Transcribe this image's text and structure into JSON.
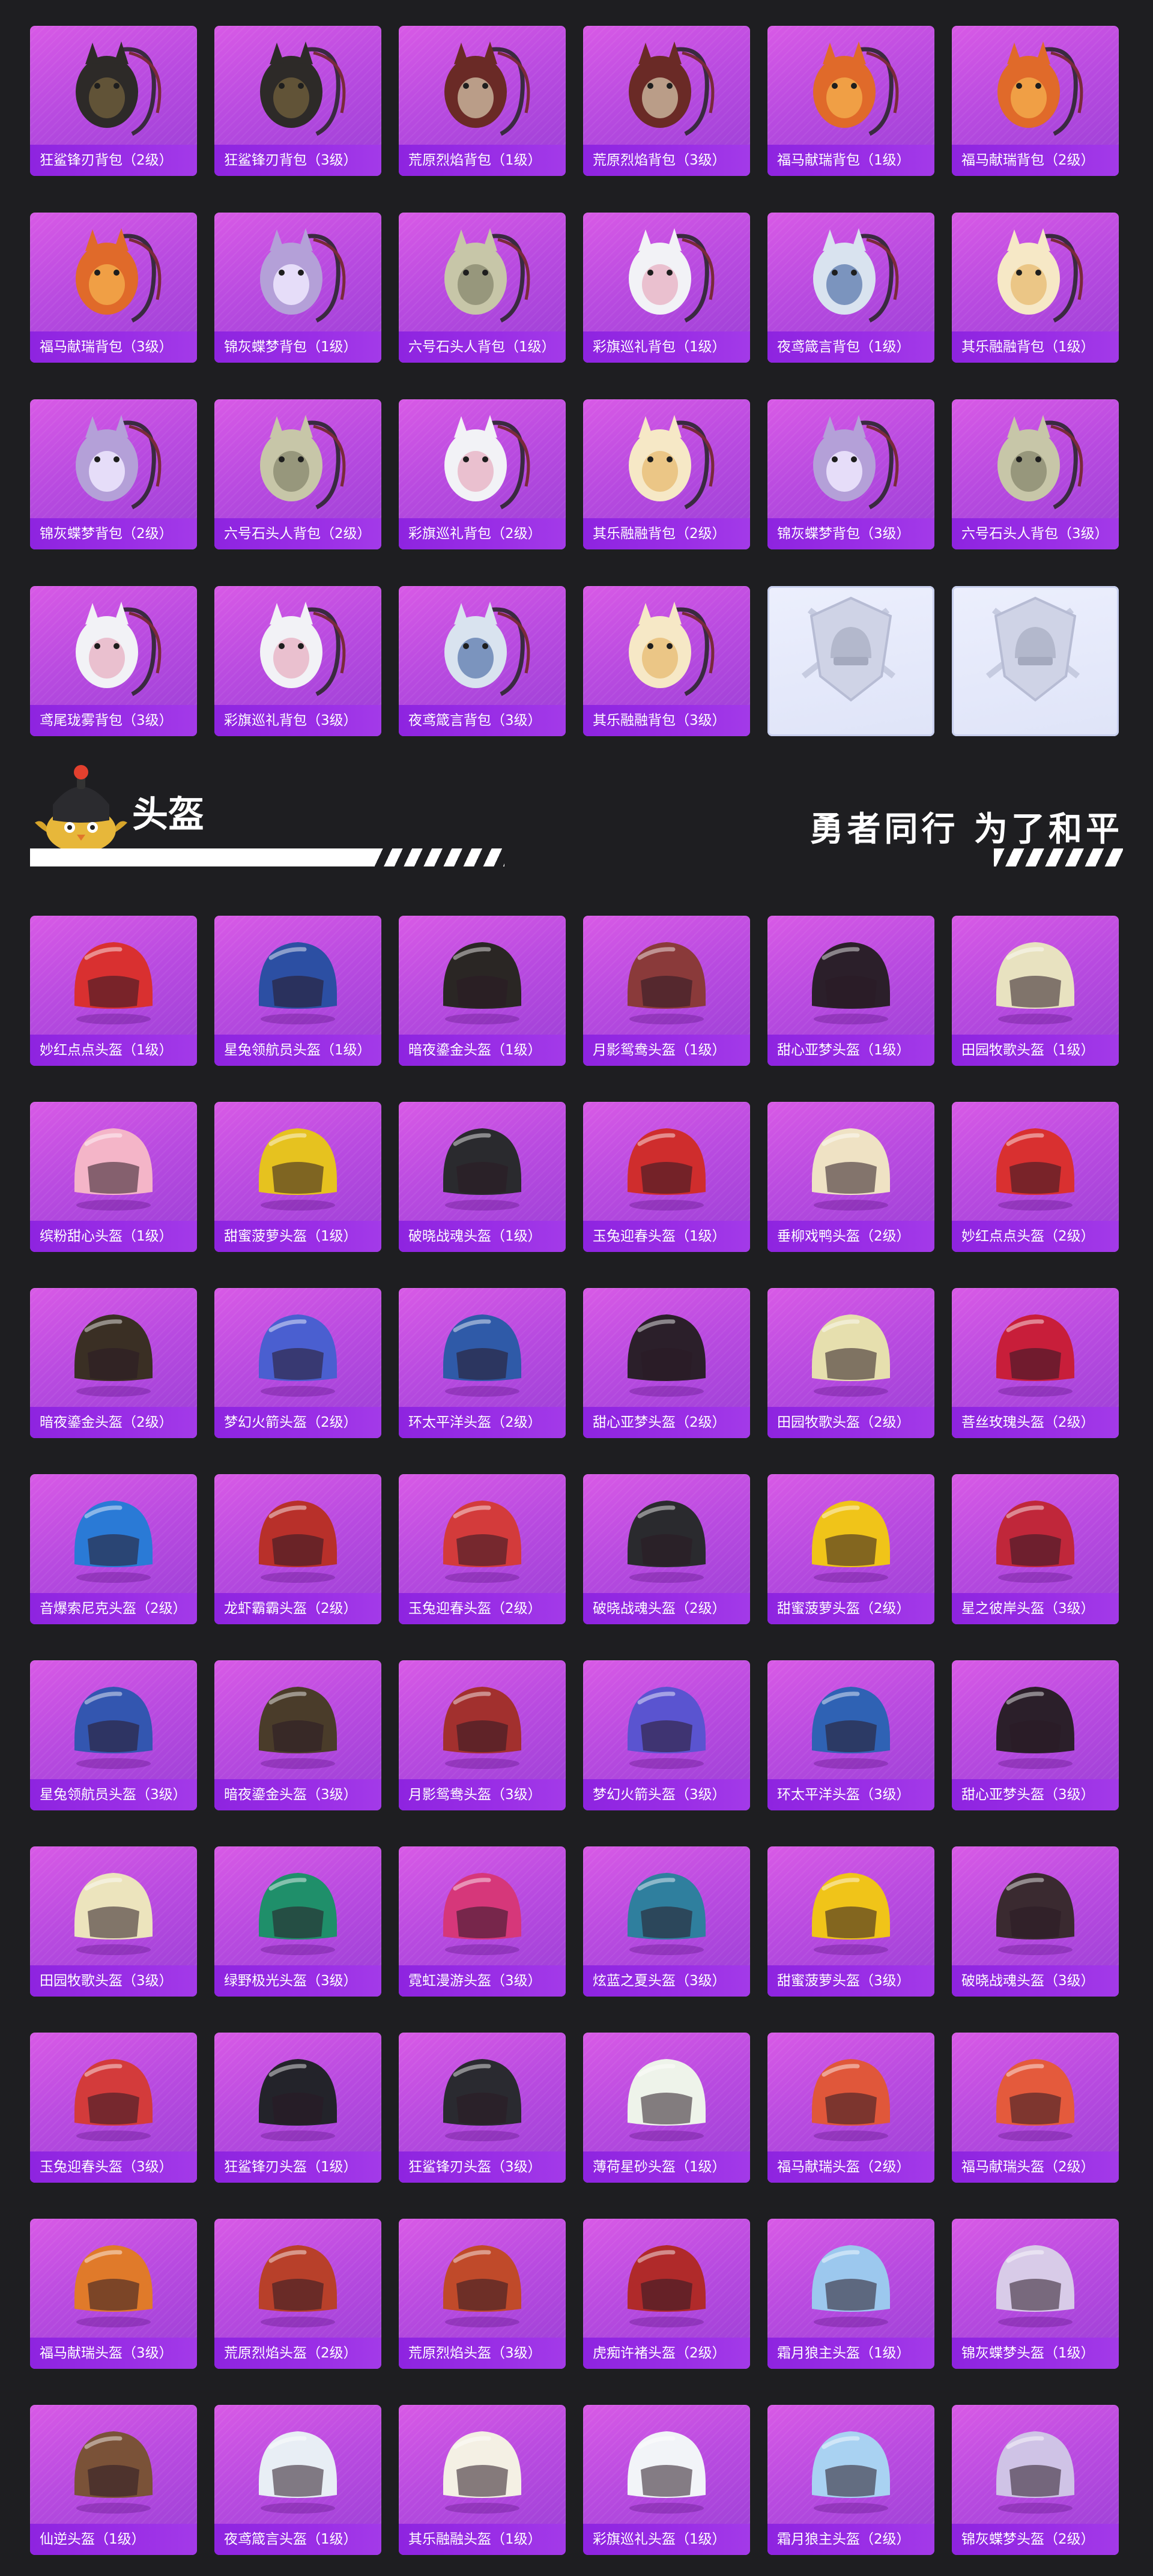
{
  "backpacks": [
    {
      "name": "狂鲨锋刃背包（2级）",
      "icon": "shark-backpack-icon"
    },
    {
      "name": "狂鲨锋刃背包（3级）",
      "icon": "shark-backpack-icon"
    },
    {
      "name": "荒原烈焰背包（1级）",
      "icon": "flame-backpack-icon"
    },
    {
      "name": "荒原烈焰背包（3级）",
      "icon": "flame-backpack-icon"
    },
    {
      "name": "福马献瑞背包（1级）",
      "icon": "horse-backpack-icon"
    },
    {
      "name": "福马献瑞背包（2级）",
      "icon": "horse-backpack-icon"
    },
    {
      "name": "福马献瑞背包（3级）",
      "icon": "horse-backpack-icon"
    },
    {
      "name": "锦灰蝶梦背包（1级）",
      "icon": "butterfly-backpack-icon"
    },
    {
      "name": "六号石头人背包（1级）",
      "icon": "stone-golem-backpack-icon"
    },
    {
      "name": "彩旗巡礼背包（1级）",
      "icon": "bunny-backpack-icon"
    },
    {
      "name": "夜鸢箴言背包（1级）",
      "icon": "kite-backpack-icon"
    },
    {
      "name": "其乐融融背包（1级）",
      "icon": "cupcake-backpack-icon"
    },
    {
      "name": "锦灰蝶梦背包（2级）",
      "icon": "butterfly-backpack-icon"
    },
    {
      "name": "六号石头人背包（2级）",
      "icon": "stone-golem-backpack-icon"
    },
    {
      "name": "彩旗巡礼背包（2级）",
      "icon": "bunny-backpack-icon"
    },
    {
      "name": "其乐融融背包（2级）",
      "icon": "cupcake-backpack-icon"
    },
    {
      "name": "锦灰蝶梦背包（3级）",
      "icon": "butterfly-backpack-icon"
    },
    {
      "name": "六号石头人背包（3级）",
      "icon": "stone-golem-backpack-icon"
    },
    {
      "name": "鸢尾珑雾背包（3级）",
      "icon": "bunny-backpack-icon"
    },
    {
      "name": "彩旗巡礼背包（3级）",
      "icon": "bunny-backpack-icon"
    },
    {
      "name": "夜鸢箴言背包（3级）",
      "icon": "kite-backpack-icon"
    },
    {
      "name": "其乐融融背包（3级）",
      "icon": "cupcake-backpack-icon"
    },
    {
      "name": "",
      "icon": "helmet-emblem-placeholder-icon",
      "placeholder": true
    },
    {
      "name": "",
      "icon": "helmet-emblem-placeholder-icon",
      "placeholder": true
    }
  ],
  "section": {
    "title": "头盔",
    "slogan": "勇者同行 为了和平",
    "mascot_icon": "chick-mascot-icon"
  },
  "helmets": [
    {
      "name": "妙红点点头盔（1级）",
      "color": "#d93030"
    },
    {
      "name": "星兔领航员头盔（1级）",
      "color": "#2c4fa3"
    },
    {
      "name": "暗夜鎏金头盔（1级）",
      "color": "#2a2624"
    },
    {
      "name": "月影鸳鸯头盔（1级）",
      "color": "#8a3a3a"
    },
    {
      "name": "甜心亚梦头盔（1级）",
      "color": "#2b1f2a"
    },
    {
      "name": "田园牧歌头盔（1级）",
      "color": "#e8e2c0"
    },
    {
      "name": "缤粉甜心头盔（1级）",
      "color": "#f4b5c8"
    },
    {
      "name": "甜蜜菠萝头盔（1级）",
      "color": "#e6c21f"
    },
    {
      "name": "破晓战魂头盔（1级）",
      "color": "#2a2a2e"
    },
    {
      "name": "玉兔迎春头盔（1级）",
      "color": "#cf2d2d"
    },
    {
      "name": "垂柳戏鸭头盔（2级）",
      "color": "#efe2c4"
    },
    {
      "name": "妙红点点头盔（2级）",
      "color": "#d93030"
    },
    {
      "name": "暗夜鎏金头盔（2级）",
      "color": "#3a2f24"
    },
    {
      "name": "梦幻火箭头盔（2级）",
      "color": "#4a5fd0"
    },
    {
      "name": "环太平洋头盔（2级）",
      "color": "#2f5aa8"
    },
    {
      "name": "甜心亚梦头盔（2级）",
      "color": "#2b1f2a"
    },
    {
      "name": "田园牧歌头盔（2级）",
      "color": "#e6dfae"
    },
    {
      "name": "菩丝玫瑰头盔（2级）",
      "color": "#c81e3a"
    },
    {
      "name": "音爆索尼克头盔（2级）",
      "color": "#2a7ad6"
    },
    {
      "name": "龙虾霸霸头盔（2级）",
      "color": "#b8302a"
    },
    {
      "name": "玉兔迎春头盔（2级）",
      "color": "#d33b3b"
    },
    {
      "name": "破晓战魂头盔（2级）",
      "color": "#2a2a2e"
    },
    {
      "name": "甜蜜菠萝头盔（2级）",
      "color": "#f0c419"
    },
    {
      "name": "星之彼岸头盔（3级）",
      "color": "#c0273a"
    },
    {
      "name": "星兔领航员头盔（3级）",
      "color": "#3356b0"
    },
    {
      "name": "暗夜鎏金头盔（3级）",
      "color": "#4a3c2a"
    },
    {
      "name": "月影鸳鸯头盔（3级）",
      "color": "#a2302e"
    },
    {
      "name": "梦幻火箭头盔（3级）",
      "color": "#5a54d0"
    },
    {
      "name": "环太平洋头盔（3级）",
      "color": "#2f62b4"
    },
    {
      "name": "甜心亚梦头盔（3级）",
      "color": "#2b1f2a"
    },
    {
      "name": "田园牧歌头盔（3级）",
      "color": "#ece4bd"
    },
    {
      "name": "绿野极光头盔（3级）",
      "color": "#1f8f6a"
    },
    {
      "name": "霓虹漫游头盔（3级）",
      "color": "#d6377a"
    },
    {
      "name": "炫蓝之夏头盔（3级）",
      "color": "#2f7f9e"
    },
    {
      "name": "甜蜜菠萝头盔（3级）",
      "color": "#f0c419"
    },
    {
      "name": "破晓战魂头盔（3级）",
      "color": "#3a2a30"
    },
    {
      "name": "玉兔迎春头盔（3级）",
      "color": "#d33b3b"
    },
    {
      "name": "狂鲨锋刃头盔（1级）",
      "color": "#23232a"
    },
    {
      "name": "狂鲨锋刃头盔（3级）",
      "color": "#2a2a30"
    },
    {
      "name": "薄荷星砂头盔（1级）",
      "color": "#eef3ea"
    },
    {
      "name": "福马献瑞头盔（2级）",
      "color": "#e0573a"
    },
    {
      "name": "福马献瑞头盔（2级）",
      "color": "#e45a3c"
    },
    {
      "name": "福马献瑞头盔（3级）",
      "color": "#e07a2a"
    },
    {
      "name": "荒原烈焰头盔（2级）",
      "color": "#b8402a"
    },
    {
      "name": "荒原烈焰头盔（3级）",
      "color": "#c04a2a"
    },
    {
      "name": "虎痴许褚头盔（2级）",
      "color": "#b02a2a"
    },
    {
      "name": "霜月狼主头盔（1级）",
      "color": "#9cc8ee"
    },
    {
      "name": "锦灰蝶梦头盔（1级）",
      "color": "#d8cbe8"
    },
    {
      "name": "仙逆头盔（1级）",
      "color": "#7a5238"
    },
    {
      "name": "夜鸢箴言头盔（1级）",
      "color": "#e8eef5"
    },
    {
      "name": "其乐融融头盔（1级）",
      "color": "#f4f0e4"
    },
    {
      "name": "彩旗巡礼头盔（1级）",
      "color": "#f2f4f8"
    },
    {
      "name": "霜月狼主头盔（2级）",
      "color": "#a9d2f2"
    },
    {
      "name": "锦灰蝶梦头盔（2级）",
      "color": "#cfc3e6"
    }
  ]
}
